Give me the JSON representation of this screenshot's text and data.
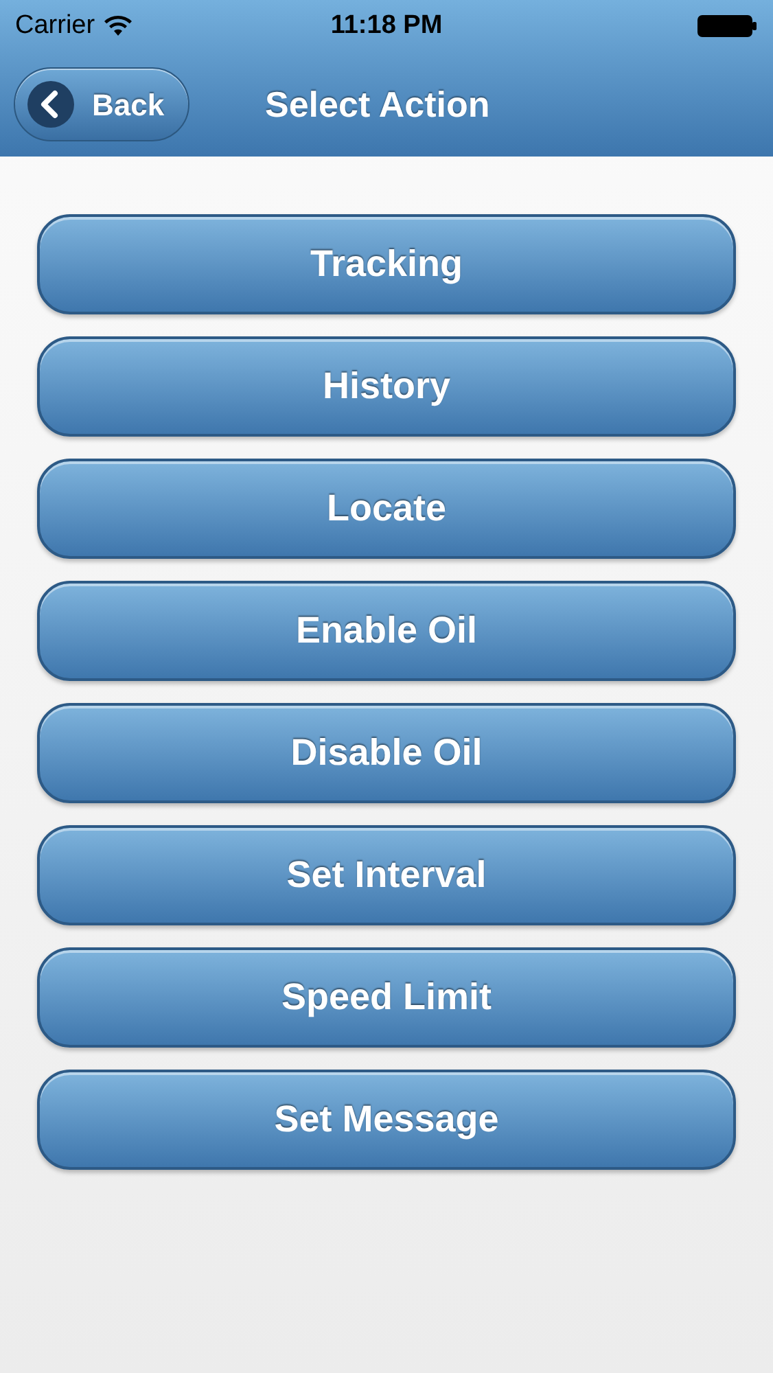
{
  "status_bar": {
    "carrier": "Carrier",
    "time": "11:18 PM"
  },
  "nav_bar": {
    "back_button": "Back",
    "title": "Select Action"
  },
  "actions": [
    "Tracking",
    "History",
    "Locate",
    "Enable Oil",
    "Disable Oil",
    "Set Interval",
    "Speed Limit",
    "Set Message"
  ]
}
